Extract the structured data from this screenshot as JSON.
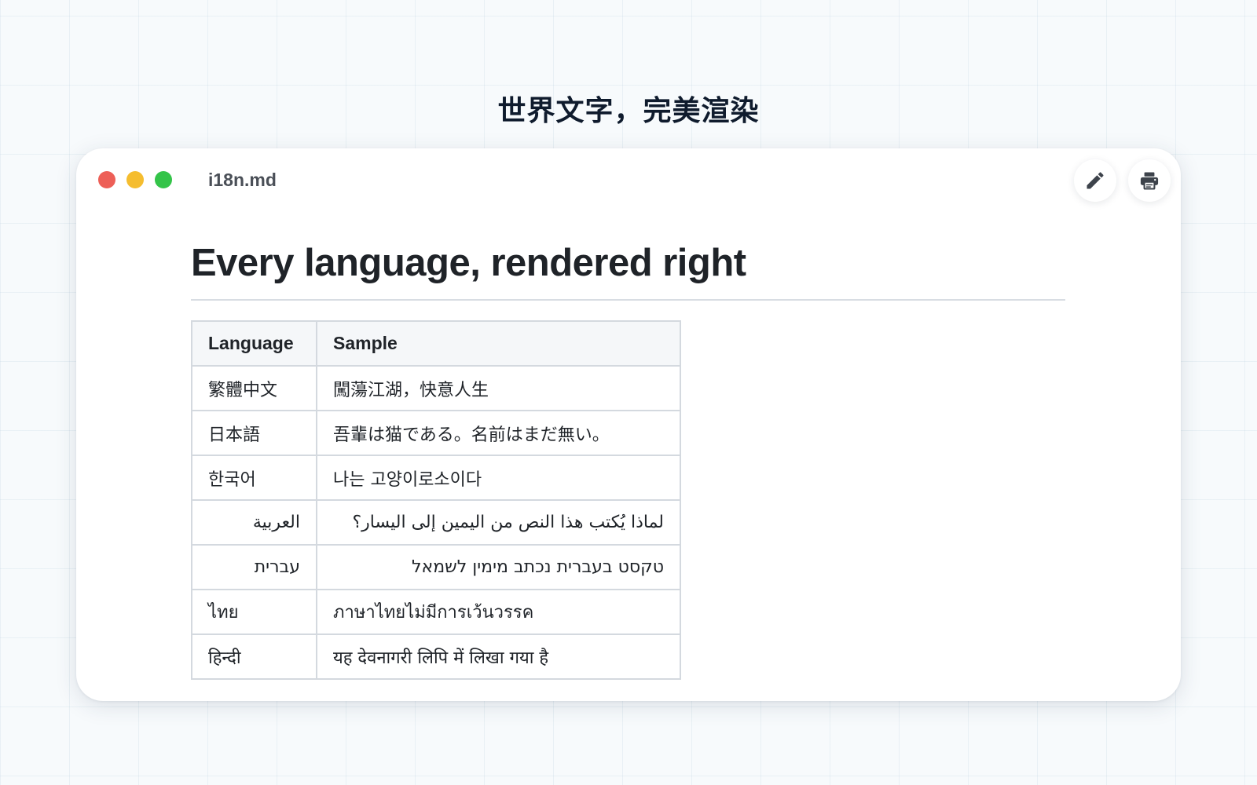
{
  "headline": "世界文字，完美渲染",
  "window": {
    "filename": "i18n.md",
    "traffic_lights": {
      "close": "#ed5f57",
      "minimize": "#f5bd2f",
      "maximize": "#34c449"
    },
    "toolbar": {
      "edit_icon": "pencil-icon",
      "print_icon": "printer-icon"
    }
  },
  "document": {
    "title": "Every language, rendered right",
    "table": {
      "headers": [
        "Language",
        "Sample"
      ],
      "rows": [
        {
          "language": "繁體中文",
          "sample": "闖蕩江湖，快意人生",
          "dir": "ltr"
        },
        {
          "language": "日本語",
          "sample": "吾輩は猫である。名前はまだ無い。",
          "dir": "ltr"
        },
        {
          "language": "한국어",
          "sample": "나는 고양이로소이다",
          "dir": "ltr"
        },
        {
          "language": "العربية",
          "sample": "لماذا يُكتب هذا النص من اليمين إلى اليسار؟",
          "dir": "rtl"
        },
        {
          "language": "עברית",
          "sample": "טקסט בעברית נכתב מימין לשמאל",
          "dir": "rtl"
        },
        {
          "language": "ไทย",
          "sample": "ภาษาไทยไม่มีการเว้นวรรค",
          "dir": "ltr"
        },
        {
          "language": "हिन्दी",
          "sample": "यह देवनागरी लिपि में लिखा गया है",
          "dir": "ltr"
        }
      ]
    }
  }
}
